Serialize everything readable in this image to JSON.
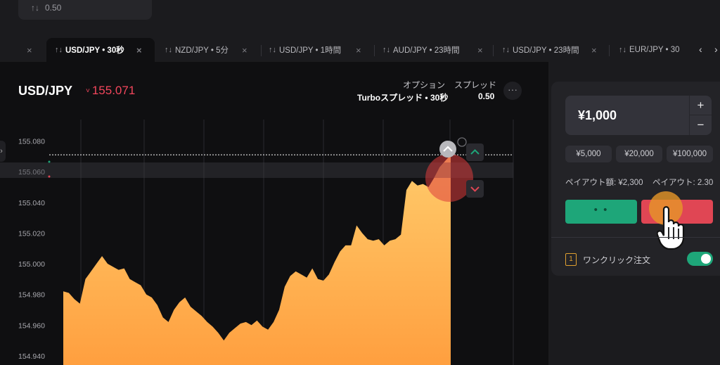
{
  "top_card": {
    "arrow": "↑↓",
    "value": "0.50"
  },
  "tabs": [
    {
      "arrow": "↑↓",
      "label": "USD/JPY • 30秒",
      "active": true
    },
    {
      "arrow": "↑↓",
      "label": "NZD/JPY • 5分"
    },
    {
      "arrow": "↑↓",
      "label": "USD/JPY • 1時間"
    },
    {
      "arrow": "↑↓",
      "label": "AUD/JPY • 23時間"
    },
    {
      "arrow": "↑↓",
      "label": "USD/JPY • 23時間"
    },
    {
      "arrow": "↑↓",
      "label": "EUR/JPY • 30"
    }
  ],
  "header": {
    "pair": "USD/JPY",
    "price_arrow": "˅",
    "price": "155.071",
    "option_label": "オプション",
    "option_value": "Turboスプレッド • 30秒",
    "spread_label": "スプレッド",
    "spread_value": "0.50",
    "more_label": "···"
  },
  "chart_data": {
    "type": "area",
    "y_ticks": [
      "155.080",
      "155.060",
      "155.040",
      "155.020",
      "155.000",
      "154.980",
      "154.960",
      "154.940"
    ],
    "ylim": [
      154.934,
      155.094
    ],
    "series": [
      {
        "values": [
          154.982,
          154.981,
          154.977,
          154.974,
          154.99,
          154.995,
          155.0,
          155.005,
          155.0,
          154.998,
          154.996,
          154.997,
          154.99,
          154.988,
          154.986,
          154.98,
          154.978,
          154.973,
          154.965,
          154.962,
          154.97,
          154.975,
          154.978,
          154.972,
          154.969,
          154.966,
          154.962,
          154.959,
          154.955,
          154.95,
          154.955,
          154.958,
          154.961,
          154.962,
          154.96,
          154.963,
          154.959,
          154.957,
          154.962,
          154.97,
          154.985,
          154.992,
          154.995,
          154.993,
          154.991,
          154.997,
          154.99,
          154.989,
          154.993,
          155.001,
          155.008,
          155.012,
          155.012,
          155.025,
          155.02,
          155.016,
          155.015,
          155.016,
          155.012,
          155.015,
          155.016,
          155.019,
          155.048,
          155.054,
          155.051,
          155.052,
          155.05,
          155.056,
          155.063,
          155.067,
          155.071
        ],
        "color": "#ffb347"
      }
    ],
    "current_price": 155.071,
    "grid": true
  },
  "panel": {
    "amount": "¥1,000",
    "plus": "+",
    "minus": "−",
    "presets": [
      "¥5,000",
      "¥20,000",
      "¥100,000"
    ],
    "payout_amount": "ペイアウト額: ¥2,300",
    "payout_rate": "ペイアウト: 2.30",
    "up_label": "• •",
    "oneclick_icon": "1",
    "oneclick_label": "ワンクリック注文"
  },
  "icons": {
    "up": "chevron-up-icon",
    "down": "chevron-down-icon",
    "prev": "chevron-left-icon",
    "next": "chevron-right-icon",
    "close": "close-icon"
  },
  "colors": {
    "up": "#1ea679",
    "down": "#e04654",
    "area": "#ffb347",
    "price": "#f2465c"
  }
}
